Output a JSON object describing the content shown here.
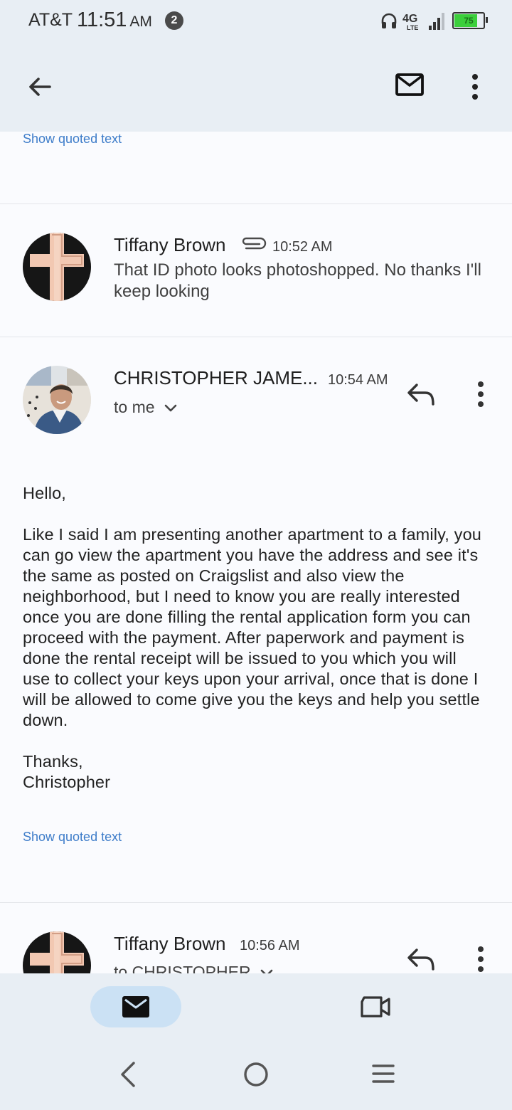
{
  "status_bar": {
    "carrier": "AT&T",
    "time": "11:51",
    "ampm": "AM",
    "notification_count": "2",
    "network": "4G LTE",
    "battery_level": "75"
  },
  "toolbar": {
    "back_icon": "arrow-left-icon",
    "mark_unread_icon": "mail-icon",
    "more_icon": "more-vertical-icon"
  },
  "thread": {
    "top_quoted_link": "Show quoted text",
    "messages": [
      {
        "sender": "Tiffany Brown",
        "has_attachment": true,
        "time": "10:52 AM",
        "snippet": "That ID photo looks photoshopped. No thanks I'll keep looking",
        "avatar": "cross-avatar"
      },
      {
        "sender": "CHRISTOPHER JAME...",
        "time": "10:54 AM",
        "recipient": "to me",
        "avatar": "man-photo-avatar",
        "greeting": "Hello,",
        "body": "Like I said I am presenting another apartment to a family, you can go view the apartment you have the address and see it's the same as posted on Craigslist and also view the neighborhood, but I need to know you are really interested once you are done filling the rental application form you can proceed with the payment. After paperwork and payment is done the rental receipt will be issued to you which you will use to collect your keys upon your arrival, once that is done I will be allowed to come give you the keys and help you settle down.",
        "signoff": "Thanks,",
        "signature": "Christopher",
        "quoted_link": "Show quoted text"
      },
      {
        "sender": "Tiffany Brown",
        "time": "10:56 AM",
        "recipient": "to CHRISTOPHER",
        "avatar": "cross-avatar"
      }
    ]
  },
  "bottom_nav": {
    "mail_tab": "mail-icon",
    "meet_tab": "video-camera-icon"
  },
  "system_nav": {
    "back": "back-chevron-icon",
    "home": "home-circle-icon",
    "recents": "menu-lines-icon"
  },
  "colors": {
    "header_bg": "#e8eef4",
    "link": "#3d7cc9",
    "active_pill": "#cbe1f4"
  }
}
